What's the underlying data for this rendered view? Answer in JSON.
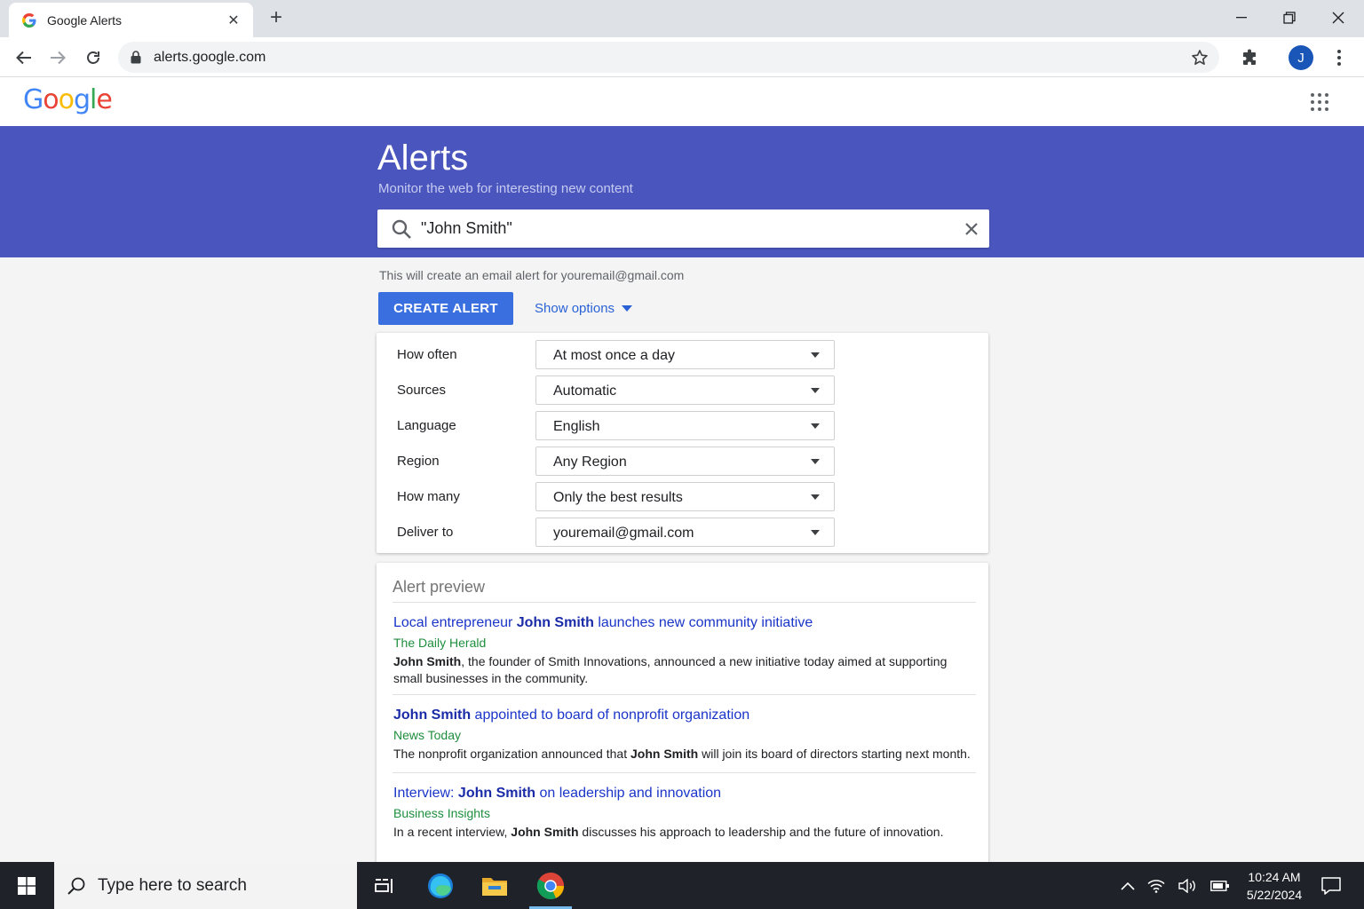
{
  "browser": {
    "tab_title": "Google Alerts",
    "url": "alerts.google.com",
    "profile_initial": "J"
  },
  "page": {
    "title": "Alerts",
    "subtitle": "Monitor the web for interesting new content",
    "search_value": "\"John Smith\"",
    "hint": "This will create an email alert for youremail@gmail.com",
    "create_label": "CREATE ALERT",
    "show_options_label": "Show options"
  },
  "options": [
    {
      "label": "How often",
      "value": "At most once a day"
    },
    {
      "label": "Sources",
      "value": "Automatic"
    },
    {
      "label": "Language",
      "value": "English"
    },
    {
      "label": "Region",
      "value": "Any Region"
    },
    {
      "label": "How many",
      "value": "Only the best results"
    },
    {
      "label": "Deliver to",
      "value": "youremail@gmail.com"
    }
  ],
  "preview": {
    "title": "Alert preview",
    "results": [
      {
        "title_pre": "Local entrepreneur ",
        "title_bold": "John Smith",
        "title_post": " launches new community initiative",
        "source": "The Daily Herald",
        "snippet_pre": "",
        "snippet_bold": "John Smith",
        "snippet_post": ", the founder of Smith Innovations, announced a new initiative today aimed at supporting small businesses in the community."
      },
      {
        "title_pre": "",
        "title_bold": "John Smith",
        "title_post": " appointed to board of nonprofit organization",
        "source": "News Today",
        "snippet_pre": "The nonprofit organization announced that ",
        "snippet_bold": "John Smith",
        "snippet_post": " will join its board of directors starting next month."
      },
      {
        "title_pre": "Interview: ",
        "title_bold": "John Smith",
        "title_post": " on leadership and innovation",
        "source": "Business Insights",
        "snippet_pre": "In a recent interview, ",
        "snippet_bold": "John Smith",
        "snippet_post": " discusses his approach to leadership and the future of innovation."
      }
    ]
  },
  "taskbar": {
    "search_placeholder": "Type here to search",
    "time": "10:24 AM",
    "date": "5/22/2024"
  },
  "colors": {
    "banner": "#4a56bd",
    "button": "#3a6fe0",
    "link": "#1a35c8",
    "source": "#1e8e3e"
  },
  "logo": {
    "letters": [
      {
        "char": "G",
        "color": "#4285f4"
      },
      {
        "char": "o",
        "color": "#ea4335"
      },
      {
        "char": "o",
        "color": "#fbbc05"
      },
      {
        "char": "g",
        "color": "#4285f4"
      },
      {
        "char": "l",
        "color": "#34a853"
      },
      {
        "char": "e",
        "color": "#ea4335"
      }
    ]
  }
}
